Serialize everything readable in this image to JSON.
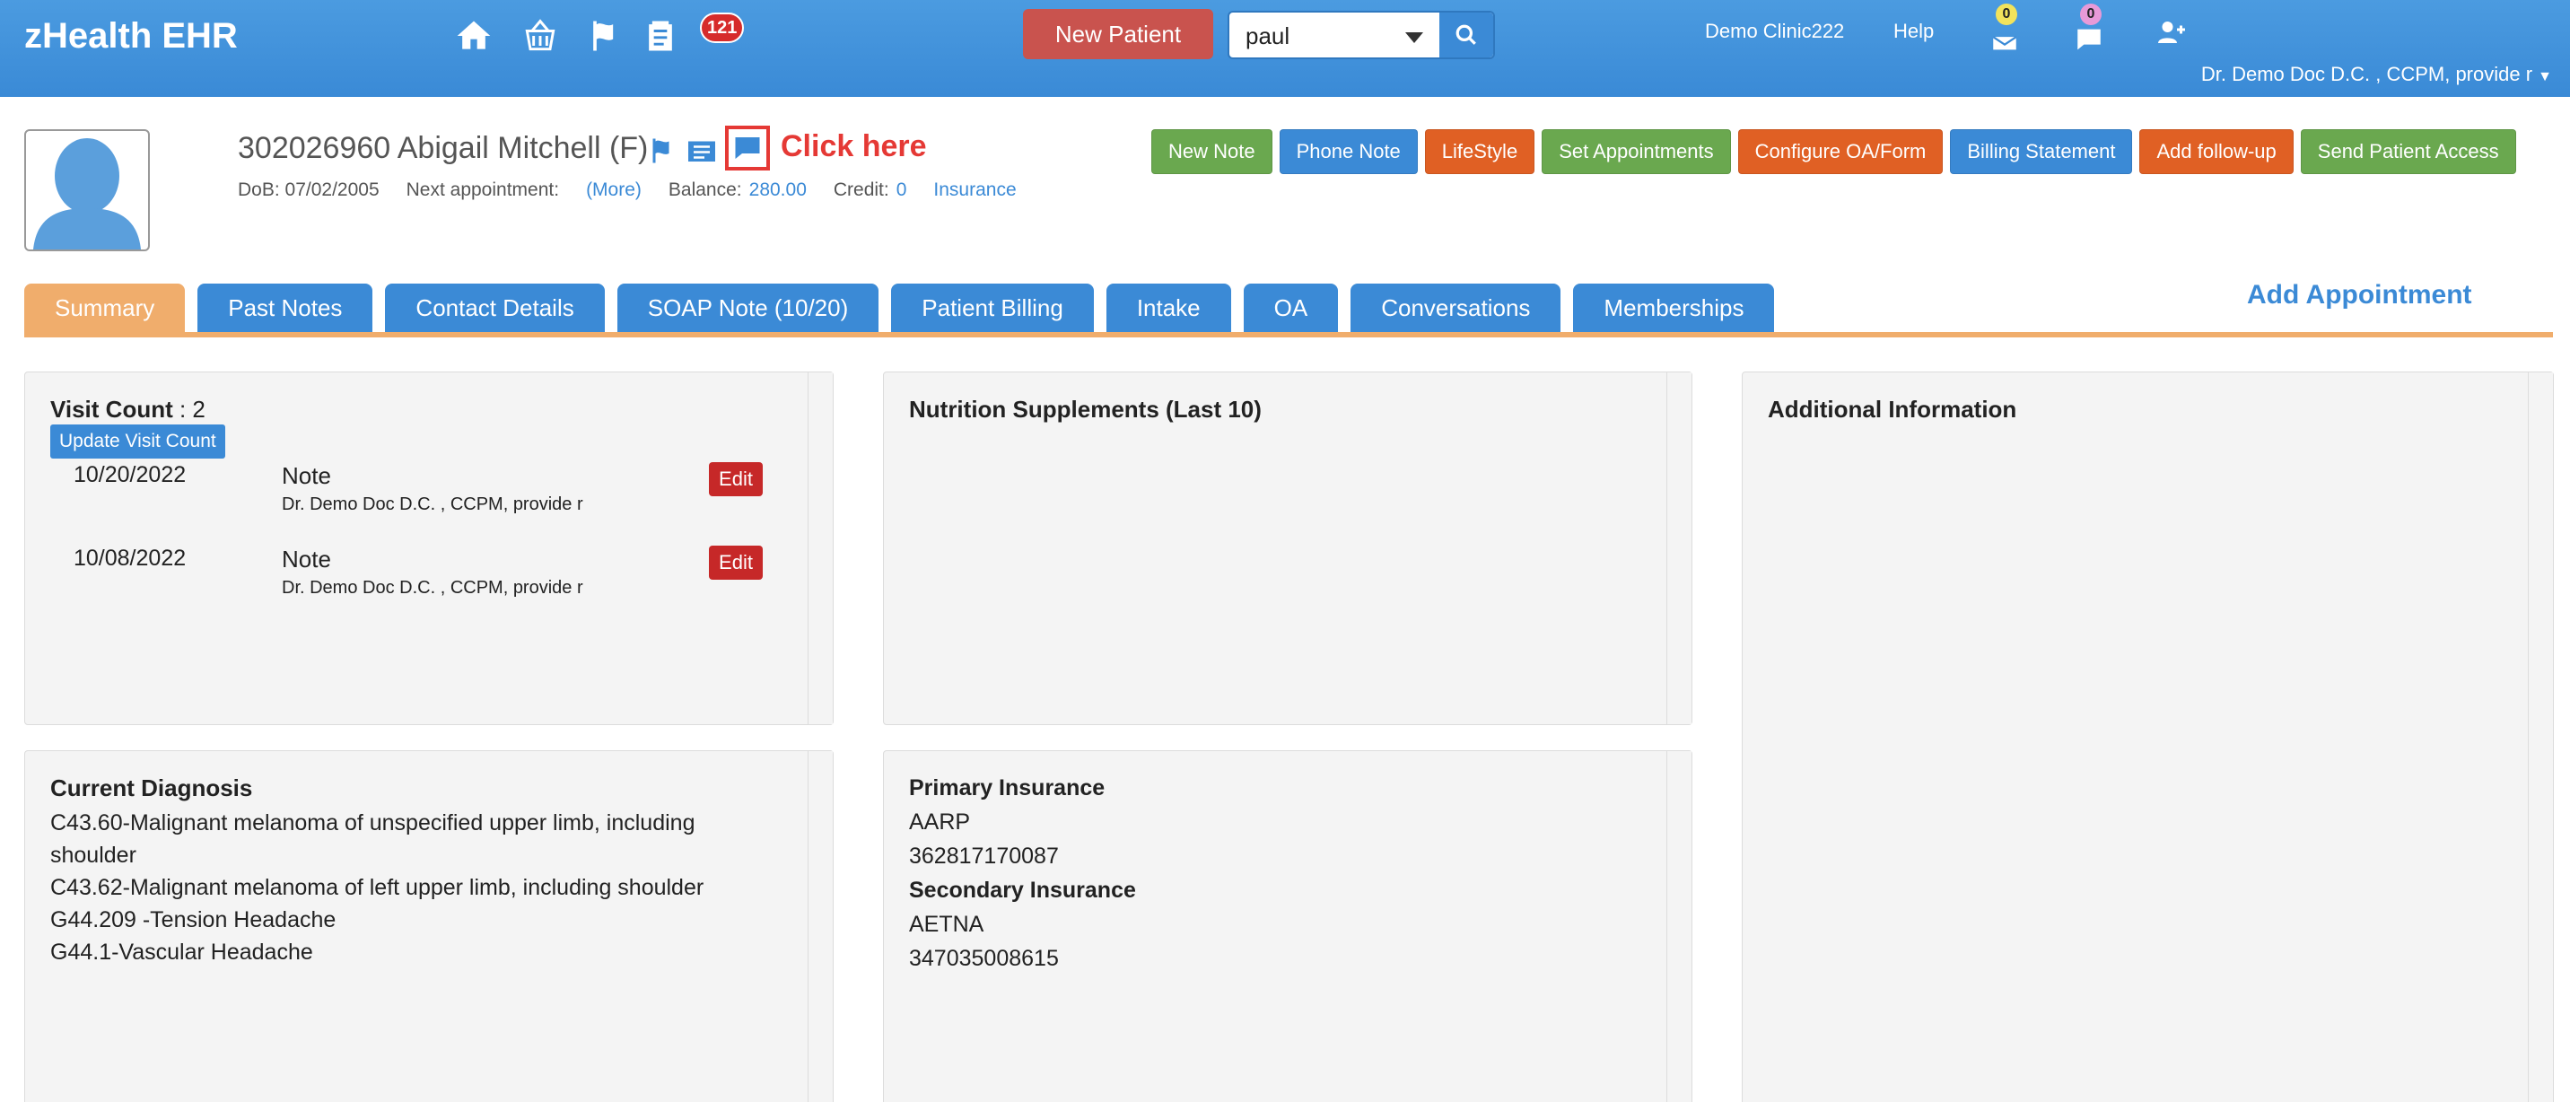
{
  "app": {
    "title": "zHealth EHR",
    "notification_count": "121",
    "new_patient_label": "New Patient",
    "search": {
      "value": "paul"
    },
    "clinic": "Demo Clinic222",
    "help": "Help",
    "inbox_count": "0",
    "messages_count": "0",
    "user": "Dr. Demo Doc D.C. , CCPM, provide r"
  },
  "patient": {
    "name": "302026960 Abigail Mitchell (F)",
    "click_here": "Click here",
    "dob": "DoB: 07/02/2005",
    "next_appt_label": "Next appointment:",
    "next_appt_more": "(More)",
    "balance_label": "Balance:",
    "balance_value": "280.00",
    "credit_label": "Credit:",
    "credit_value": "0",
    "insurance_link": "Insurance"
  },
  "actions": [
    {
      "label": "New Note",
      "color": "#6aa84f"
    },
    {
      "label": "Phone Note",
      "color": "#3b8ad6"
    },
    {
      "label": "LifeStyle",
      "color": "#e06024"
    },
    {
      "label": "Set Appointments",
      "color": "#6aa84f"
    },
    {
      "label": "Configure OA/Form",
      "color": "#e06024"
    },
    {
      "label": "Billing Statement",
      "color": "#3b8ad6"
    },
    {
      "label": "Add follow-up",
      "color": "#e06024"
    },
    {
      "label": "Send Patient Access",
      "color": "#6aa84f"
    }
  ],
  "tabs": [
    {
      "label": "Summary",
      "active": true
    },
    {
      "label": "Past Notes"
    },
    {
      "label": "Contact Details"
    },
    {
      "label": "SOAP Note (10/20)"
    },
    {
      "label": "Patient Billing"
    },
    {
      "label": "Intake"
    },
    {
      "label": "OA"
    },
    {
      "label": "Conversations"
    },
    {
      "label": "Memberships"
    }
  ],
  "add_appointment": "Add Appointment",
  "visits": {
    "label": "Visit Count",
    "count": ": 2",
    "update_label": "Update Visit Count",
    "notes": [
      {
        "date": "10/20/2022",
        "type": "Note",
        "doctor": "Dr. Demo Doc D.C. , CCPM, provide r",
        "edit": "Edit"
      },
      {
        "date": "10/08/2022",
        "type": "Note",
        "doctor": "Dr. Demo Doc D.C. , CCPM, provide r",
        "edit": "Edit"
      }
    ]
  },
  "nutrition_title": "Nutrition Supplements (Last 10)",
  "additional_title": "Additional Information",
  "diagnosis": {
    "title": "Current Diagnosis",
    "items": [
      "C43.60-Malignant melanoma of unspecified upper limb, including shoulder",
      "C43.62-Malignant melanoma of left upper limb, including shoulder",
      "G44.209 -Tension Headache",
      "G44.1-Vascular Headache"
    ]
  },
  "insurance": {
    "primary_label": "Primary Insurance",
    "primary_name": "AARP",
    "primary_id": "362817170087",
    "secondary_label": "Secondary Insurance",
    "secondary_name": "AETNA",
    "secondary_id": "347035008615"
  }
}
